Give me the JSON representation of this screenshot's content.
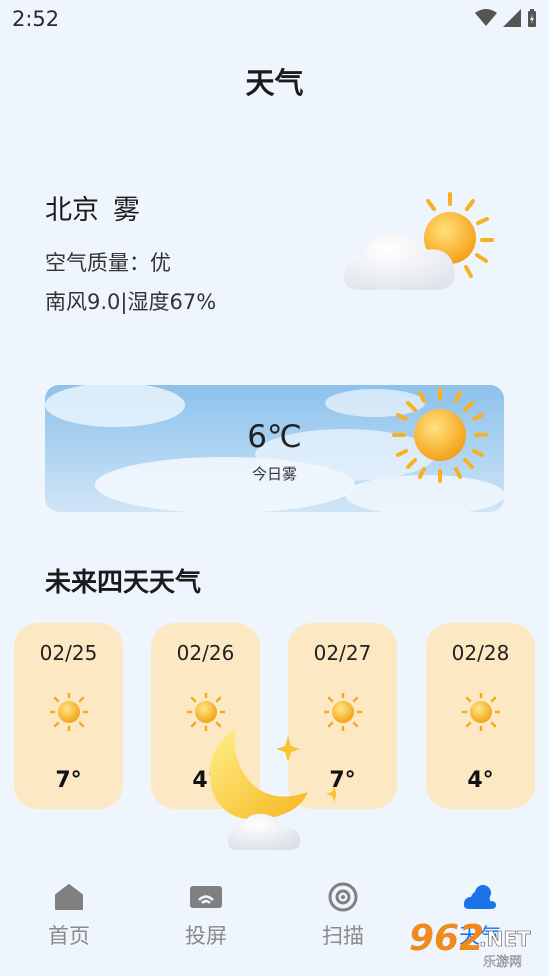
{
  "status_bar": {
    "time": "2:52"
  },
  "page": {
    "title": "天气"
  },
  "current": {
    "city": "北京",
    "condition": "雾",
    "air_quality": "空气质量：优",
    "wind_humidity": "南风9.0|湿度67%",
    "icon": "partly-cloudy-icon"
  },
  "today": {
    "temp": "6℃",
    "desc": "今日雾",
    "icon": "sun-icon"
  },
  "forecast": {
    "heading": "未来四天天气",
    "days": [
      {
        "date": "02/25",
        "temp": "7°",
        "icon": "sun-icon"
      },
      {
        "date": "02/26",
        "temp": "4°",
        "icon": "sun-icon"
      },
      {
        "date": "02/27",
        "temp": "7°",
        "icon": "sun-icon"
      },
      {
        "date": "02/28",
        "temp": "4°",
        "icon": "sun-icon"
      }
    ]
  },
  "nav": {
    "items": [
      {
        "label": "首页",
        "icon": "home-icon"
      },
      {
        "label": "投屏",
        "icon": "cast-icon"
      },
      {
        "label": "扫描",
        "icon": "target-icon"
      },
      {
        "label": "天气",
        "icon": "weather-icon"
      }
    ],
    "active_index": 3
  },
  "watermark": {
    "brand": "962",
    "suffix": ".NET",
    "caption": "乐游网"
  },
  "colors": {
    "accent": "#1a73e8",
    "card_bg": "#fce8c3",
    "page_bg": "#eef5fd"
  }
}
